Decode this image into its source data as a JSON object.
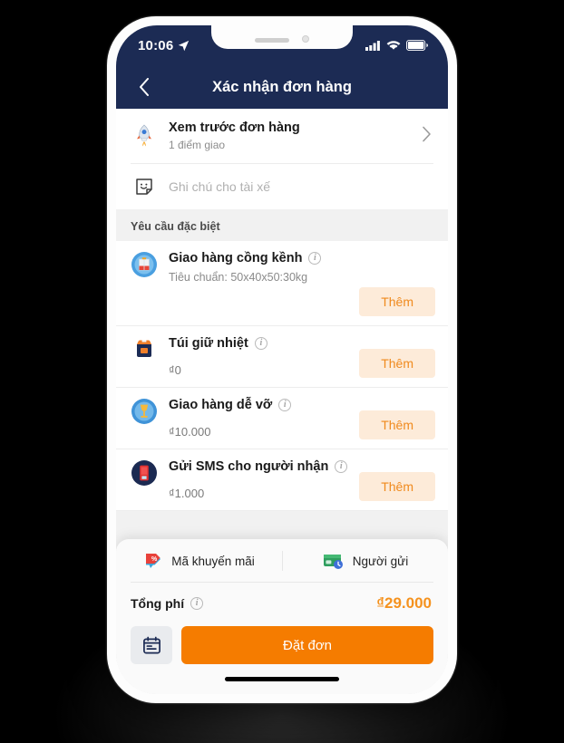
{
  "status_bar": {
    "time": "10:06",
    "location_icon": "location-arrow-icon",
    "signal_icon": "cellular-signal-icon",
    "wifi_icon": "wifi-icon",
    "battery_icon": "battery-icon"
  },
  "header": {
    "title": "Xác nhận đơn hàng",
    "back_icon": "chevron-left-icon"
  },
  "preview": {
    "icon": "rocket-icon",
    "title": "Xem trước đơn hàng",
    "subtitle": "1 điểm giao",
    "chevron": "chevron-right-icon"
  },
  "note": {
    "icon": "note-icon",
    "placeholder": "Ghi chú cho tài xế"
  },
  "section": {
    "title": "Yêu cầu đặc biệt"
  },
  "options": [
    {
      "icon": "bulky-box-icon",
      "title": "Giao hàng cồng kềnh",
      "desc": "Tiêu chuẩn: 50x40x50:30kg",
      "price": "",
      "add_label": "Thêm",
      "info_icon": "info-icon"
    },
    {
      "icon": "cooler-bag-icon",
      "title": "Túi giữ nhiệt",
      "desc": "",
      "price": "₫0",
      "add_label": "Thêm",
      "info_icon": "info-icon"
    },
    {
      "icon": "fragile-glass-icon",
      "title": "Giao hàng dễ vỡ",
      "desc": "",
      "price": "₫10.000",
      "add_label": "Thêm",
      "info_icon": "info-icon"
    },
    {
      "icon": "sms-phone-icon",
      "title": "Gửi SMS cho người nhận",
      "desc": "",
      "price": "₫1.000",
      "add_label": "Thêm",
      "info_icon": "info-icon"
    }
  ],
  "sheet": {
    "promo": {
      "icon": "coupon-tag-icon",
      "label": "Mã khuyến mãi"
    },
    "sender": {
      "icon": "payment-card-icon",
      "label": "Người gửi"
    },
    "total": {
      "label": "Tổng phí",
      "info_icon": "info-icon",
      "value": "₫29.000"
    },
    "schedule_icon": "calendar-icon",
    "order_label": "Đặt đơn"
  },
  "colors": {
    "header_navy": "#1c2b54",
    "accent_orange": "#f57c00",
    "add_bg": "#fdebd9",
    "add_text": "#f08a1d"
  }
}
